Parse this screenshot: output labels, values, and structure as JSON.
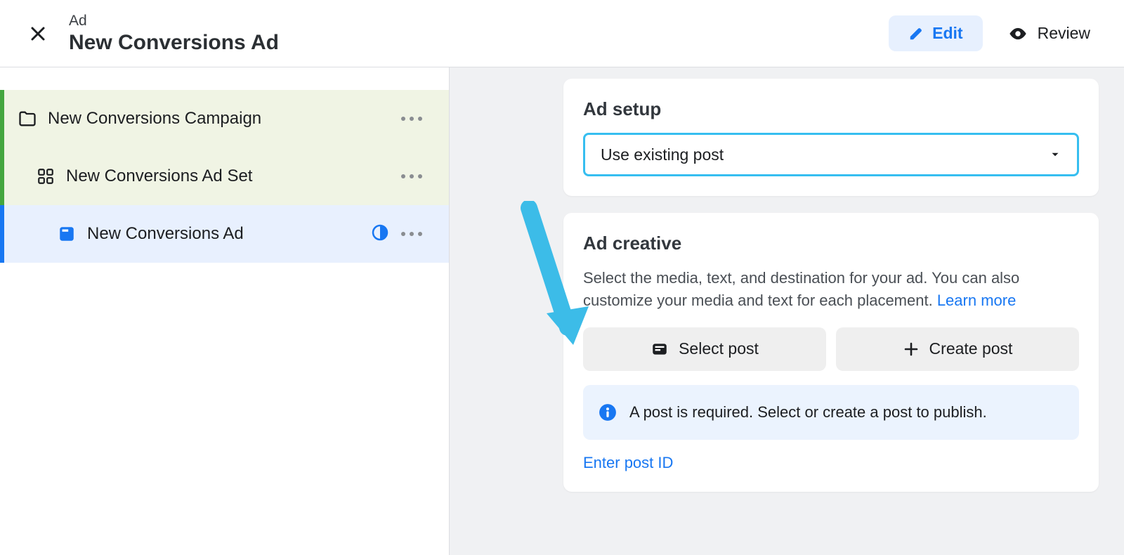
{
  "header": {
    "eyebrow": "Ad",
    "title": "New Conversions Ad",
    "edit_label": "Edit",
    "review_label": "Review"
  },
  "tree": {
    "campaign_label": "New Conversions Campaign",
    "adset_label": "New Conversions Ad Set",
    "ad_label": "New Conversions Ad"
  },
  "ad_setup": {
    "title": "Ad setup",
    "select_value": "Use existing post"
  },
  "ad_creative": {
    "title": "Ad creative",
    "description": "Select the media, text, and destination for your ad. You can also customize your media and text for each placement. ",
    "learn_more": "Learn more",
    "select_post_label": "Select post",
    "create_post_label": "Create post",
    "info_message": "A post is required. Select or create a post to publish.",
    "enter_post_id_label": "Enter post ID"
  }
}
